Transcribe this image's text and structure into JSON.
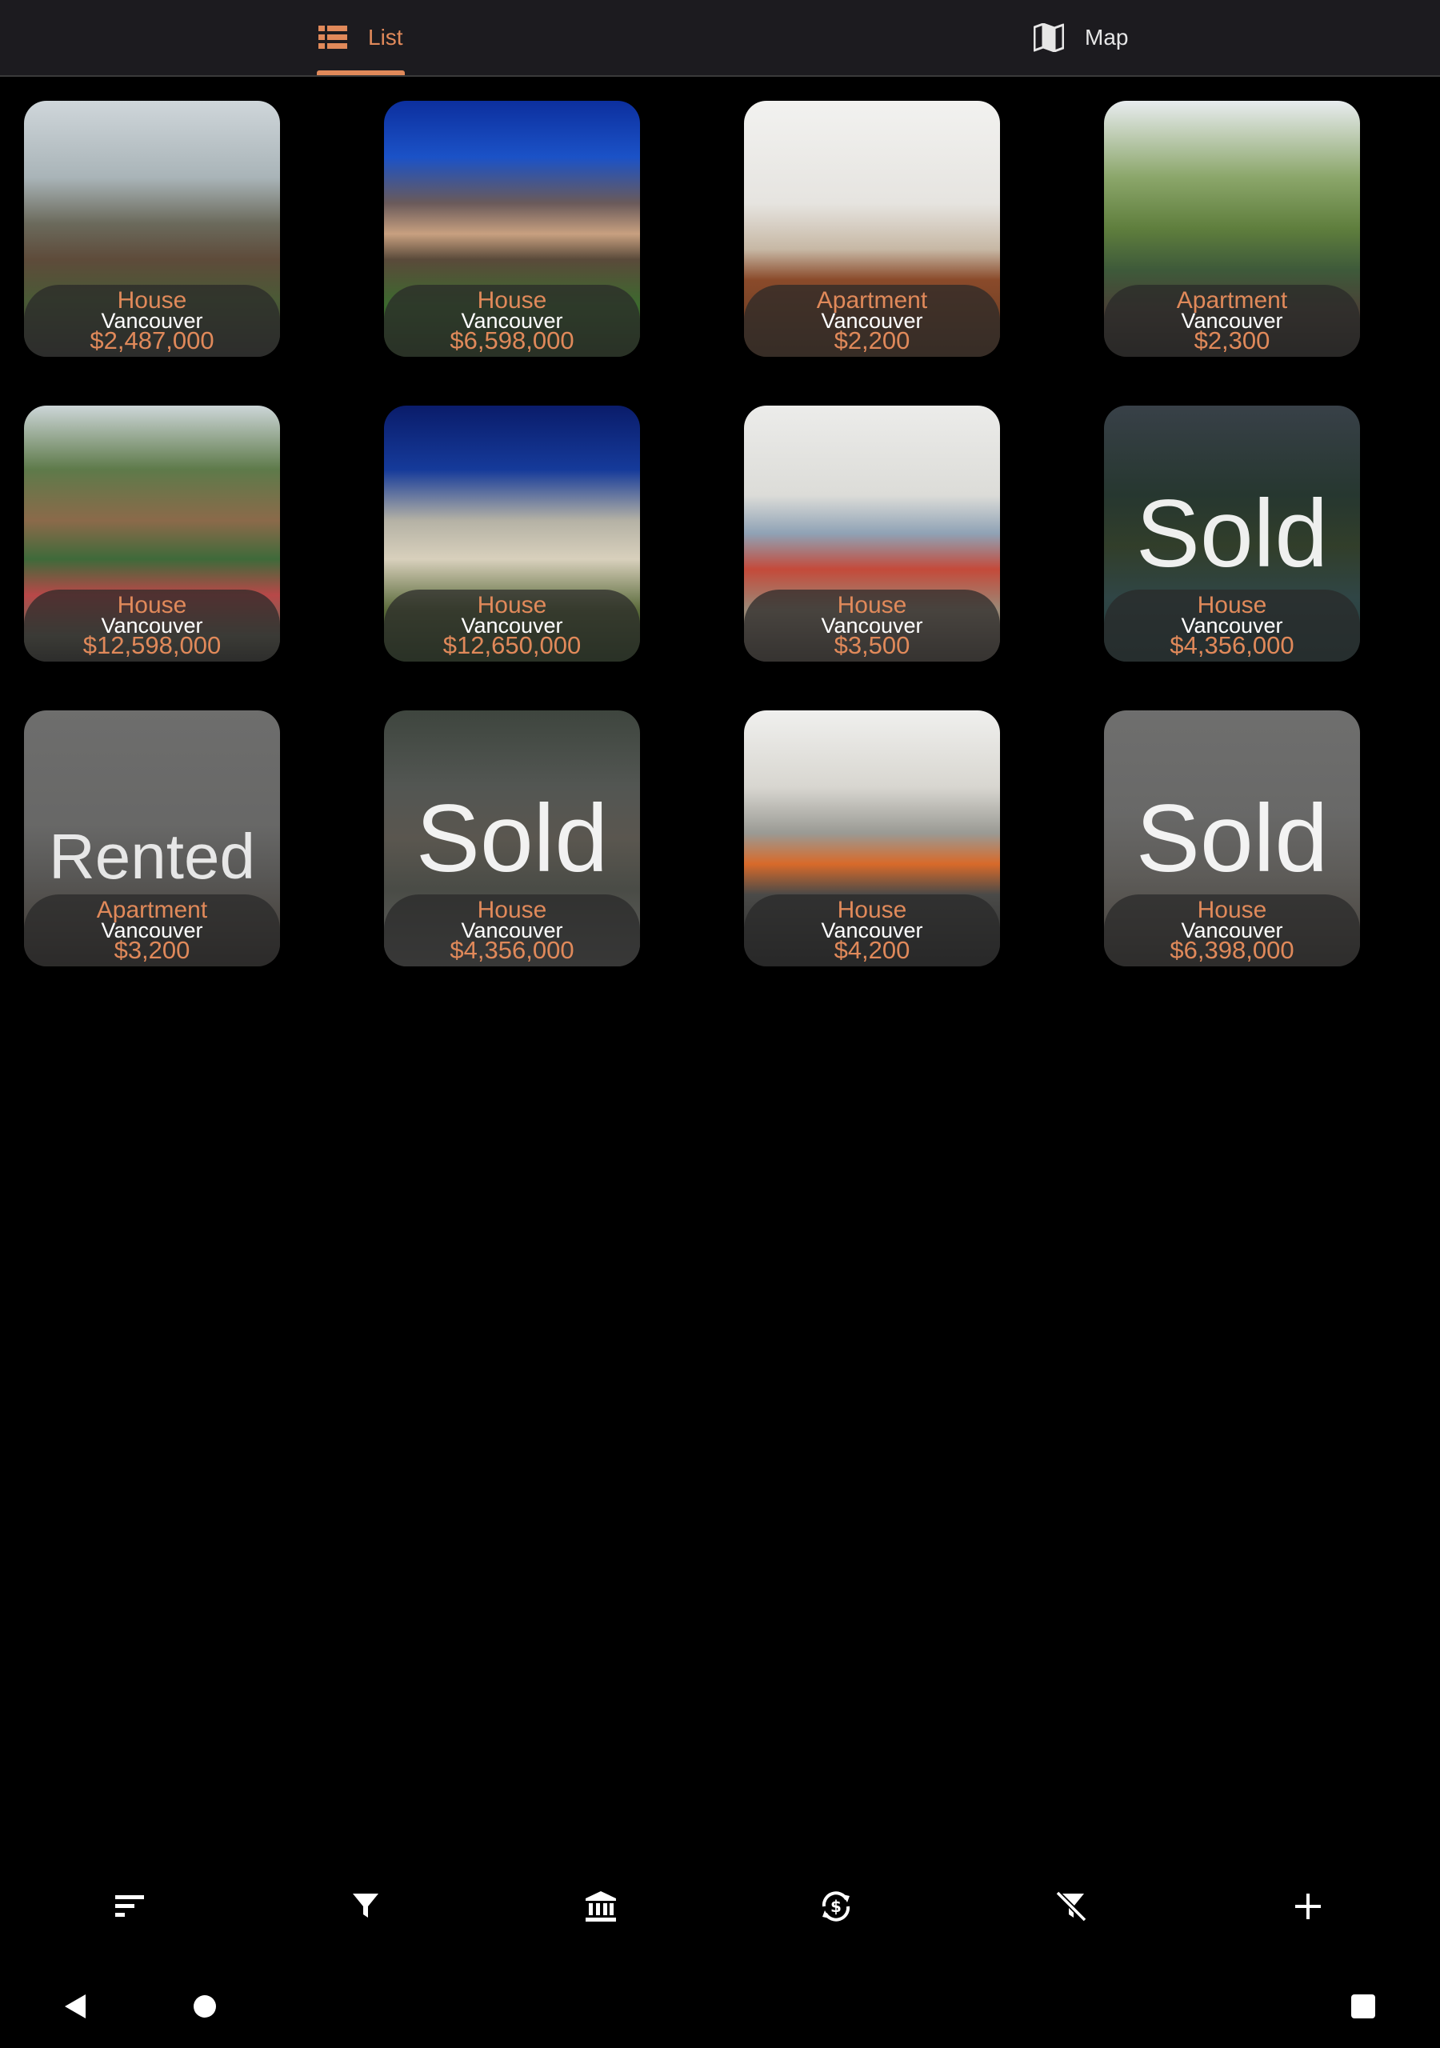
{
  "tabs": [
    {
      "label": "List",
      "icon": "list-icon",
      "selected": true
    },
    {
      "label": "Map",
      "icon": "map-icon",
      "selected": false
    }
  ],
  "colors": {
    "accent": "#e0895a",
    "bar_background": "#1c1b1f",
    "background": "#000000"
  },
  "listings": [
    {
      "type": "House",
      "city": "Vancouver",
      "price": "$2,487,000",
      "status": ""
    },
    {
      "type": "House",
      "city": "Vancouver",
      "price": "$6,598,000",
      "status": ""
    },
    {
      "type": "Apartment",
      "city": "Vancouver",
      "price": "$2,200",
      "status": ""
    },
    {
      "type": "Apartment",
      "city": "Vancouver",
      "price": "$2,300",
      "status": ""
    },
    {
      "type": "House",
      "city": "Vancouver",
      "price": "$12,598,000",
      "status": ""
    },
    {
      "type": "House",
      "city": "Vancouver",
      "price": "$12,650,000",
      "status": ""
    },
    {
      "type": "House",
      "city": "Vancouver",
      "price": "$3,500",
      "status": ""
    },
    {
      "type": "House",
      "city": "Vancouver",
      "price": "$4,356,000",
      "status": "Sold"
    },
    {
      "type": "Apartment",
      "city": "Vancouver",
      "price": "$3,200",
      "status": "Rented"
    },
    {
      "type": "House",
      "city": "Vancouver",
      "price": "$4,356,000",
      "status": "Sold"
    },
    {
      "type": "House",
      "city": "Vancouver",
      "price": "$4,200",
      "status": ""
    },
    {
      "type": "House",
      "city": "Vancouver",
      "price": "$6,398,000",
      "status": "Sold"
    }
  ],
  "toolbar": [
    {
      "icon": "sort-icon"
    },
    {
      "icon": "filter-icon"
    },
    {
      "icon": "bank-icon"
    },
    {
      "icon": "currency-exchange-icon"
    },
    {
      "icon": "clear-filter-icon"
    },
    {
      "icon": "add-icon"
    }
  ],
  "system_nav": [
    {
      "icon": "back-icon"
    },
    {
      "icon": "home-icon"
    },
    {
      "icon": "recents-icon"
    }
  ]
}
